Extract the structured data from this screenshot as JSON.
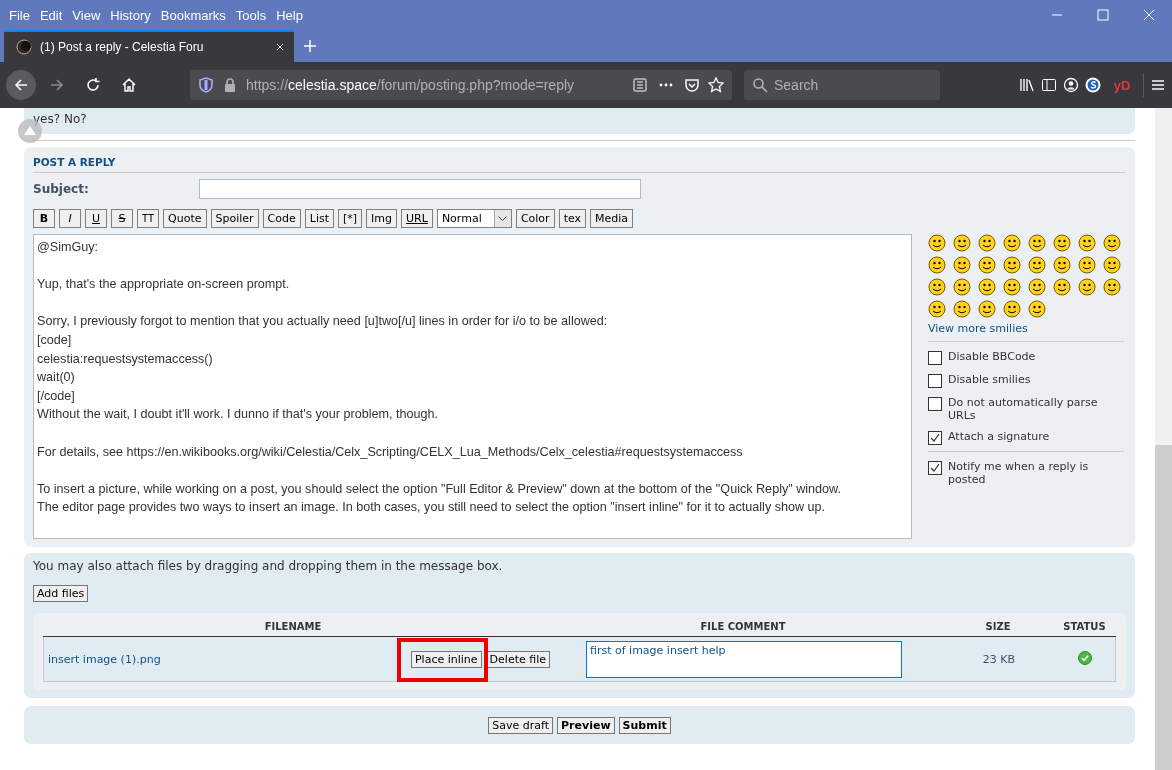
{
  "menu_bar": {
    "items": [
      "File",
      "Edit",
      "View",
      "History",
      "Bookmarks",
      "Tools",
      "Help"
    ]
  },
  "tab_bar": {
    "tabs": [
      {
        "title": "(1) Post a reply - Celestia Foru",
        "selected": true
      }
    ]
  },
  "nav_bar": {
    "url": {
      "scheme": "https://",
      "host": "celestia.space",
      "path": "/forum/posting.php?mode=reply"
    },
    "search": {
      "placeholder": "Search"
    },
    "extension_label": "yD"
  },
  "previous_post": {
    "text": "yes? No?"
  },
  "post_form": {
    "heading": "POST A REPLY",
    "subject": {
      "label": "Subject:"
    },
    "toolbar": [
      {
        "label": "B",
        "kind": "bold"
      },
      {
        "label": "I",
        "kind": "italic"
      },
      {
        "label": "U",
        "kind": "underline"
      },
      {
        "label": "S",
        "kind": "strike"
      },
      {
        "label": "TT",
        "kind": "mono"
      },
      {
        "label": "Quote",
        "kind": "plain"
      },
      {
        "label": "Spoiler",
        "kind": "plain"
      },
      {
        "label": "Code",
        "kind": "plain"
      },
      {
        "label": "List",
        "kind": "plain"
      },
      {
        "label": "[*]",
        "kind": "plain"
      },
      {
        "label": "Img",
        "kind": "plain"
      },
      {
        "label": "URL",
        "kind": "underline"
      },
      {
        "label": "Normal",
        "kind": "select"
      },
      {
        "label": "Color",
        "kind": "plain"
      },
      {
        "label": "tex",
        "kind": "plain"
      },
      {
        "label": "Media",
        "kind": "plain"
      }
    ],
    "message": "@SimGuy:\n\nYup, that's the appropriate on-screen prompt.\n\nSorry, I previously forgot to mention that you actually need [u]two[/u] lines in order for i/o to be allowed:\n[code]\ncelestia:requestsystemaccess()\nwait(0)\n[/code]\nWithout the wait, I doubt it'll work. I dunno if that's your problem, though.\n\nFor details, see https://en.wikibooks.org/wiki/Celestia/Celx_Scripting/CELX_Lua_Methods/Celx_celestia#requestsystemaccess\n\nTo insert a picture, while working on a post, you should select the option \"Full Editor & Preview\" down at the bottom of the \"Quick Reply\" window.\nThe editor page provides two ways to insert an image. In both cases, you still need to select the option \"insert inline\" for it to actually show up.",
    "more_smilies": "View more smilies",
    "options": [
      {
        "label": "Disable BBCode",
        "checked": false
      },
      {
        "label": "Disable smilies",
        "checked": false
      },
      {
        "label": "Do not automatically parse URLs",
        "checked": false
      },
      {
        "label": "Attach a signature",
        "checked": true
      }
    ],
    "notify": {
      "label": "Notify me when a reply is posted",
      "checked": true
    }
  },
  "attachments": {
    "hint": "You may also attach files by dragging and dropping them in the message box.",
    "add_button": "Add files",
    "columns": [
      "FILENAME",
      "FILE COMMENT",
      "SIZE",
      "STATUS"
    ],
    "rows": [
      {
        "filename": "insert image (1).png",
        "place_button": {
          "label": "Place inline",
          "highlighted": true
        },
        "delete_button": "Delete file",
        "comment": "first of image insert help",
        "size": "23 KB",
        "uploaded": true
      }
    ]
  },
  "actions": [
    {
      "label": "Save draft",
      "kind": "normal"
    },
    {
      "label": "Preview",
      "kind": "primary"
    },
    {
      "label": "Submit",
      "kind": "primary"
    }
  ]
}
